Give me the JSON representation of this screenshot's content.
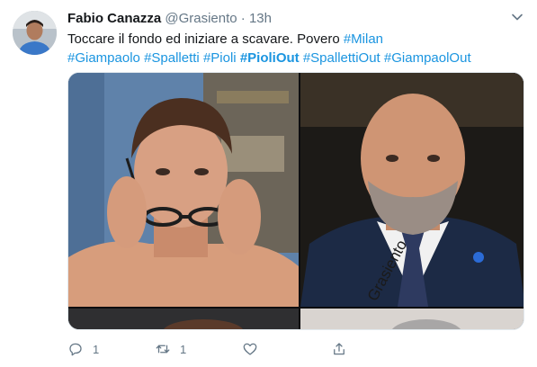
{
  "tweet": {
    "author_name": "Fabio Canazza",
    "handle": "@Grasiento",
    "separator": "·",
    "time": "13h",
    "text_lines": [
      [
        {
          "t": "Toccare il fondo ed iniziare a scavare. Povero ",
          "kind": "plain"
        },
        {
          "t": "#Milan",
          "kind": "tag"
        }
      ],
      [
        {
          "t": "#Giampaolo",
          "kind": "tag"
        },
        {
          "t": " ",
          "kind": "plain"
        },
        {
          "t": "#Spalletti",
          "kind": "tag"
        },
        {
          "t": " ",
          "kind": "plain"
        },
        {
          "t": "#Pioli",
          "kind": "tag"
        },
        {
          "t": " ",
          "kind": "plain"
        },
        {
          "t": "#PioliOut",
          "kind": "tag-bold"
        },
        {
          "t": " ",
          "kind": "plain"
        },
        {
          "t": "#SpallettiOut",
          "kind": "tag"
        },
        {
          "t": " ",
          "kind": "plain"
        },
        {
          "t": "#GiampaolOut",
          "kind": "tag"
        }
      ]
    ],
    "media_watermark": "Grasiento",
    "actions": {
      "reply_count": "1",
      "retweet_count": "1"
    },
    "colors": {
      "link": "#1b95e0",
      "muted": "#657786"
    },
    "icons": [
      "chevron-down-icon",
      "reply-icon",
      "retweet-icon",
      "like-icon",
      "share-icon"
    ]
  }
}
